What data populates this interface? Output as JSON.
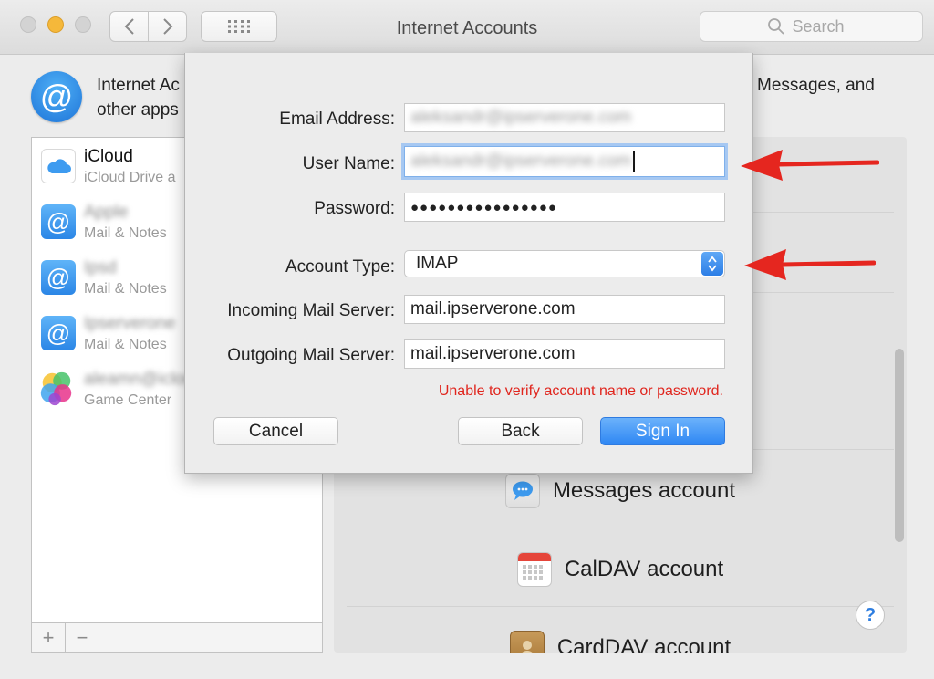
{
  "window": {
    "title": "Internet Accounts",
    "search_placeholder": "Search"
  },
  "header": {
    "description_line1": "Internet Ac",
    "description_line2": "other apps",
    "description_right": "Messages, and"
  },
  "accounts": [
    {
      "name": "iCloud",
      "subtitle": "iCloud Drive a",
      "icon": "cloud-icon",
      "name_blurred": false
    },
    {
      "name": "Apple",
      "subtitle": "Mail & Notes",
      "icon": "at-icon",
      "name_blurred": true
    },
    {
      "name": "Ipsd",
      "subtitle": "Mail & Notes",
      "icon": "at-icon",
      "name_blurred": true
    },
    {
      "name": "Ipserverone",
      "subtitle": "Mail & Notes",
      "icon": "at-icon",
      "name_blurred": true
    },
    {
      "name": "aleamn@icloud",
      "subtitle": "Game Center",
      "icon": "game-center-icon",
      "name_blurred": true
    }
  ],
  "list_controls": {
    "add": "+",
    "remove": "−"
  },
  "providers": [
    {
      "label": "Messages account",
      "icon": "messages-icon"
    },
    {
      "label": "CalDAV account",
      "icon": "calendar-icon"
    },
    {
      "label": "CardDAV account",
      "icon": "contacts-icon"
    }
  ],
  "help": "?",
  "sheet": {
    "email_label": "Email Address:",
    "email_value": "aleksandr@ipserverone.com",
    "username_label": "User Name:",
    "username_value": "aleksandr@ipserverone.com",
    "password_label": "Password:",
    "password_value": "●●●●●●●●●●●●●●●●",
    "account_type_label": "Account Type:",
    "account_type_value": "IMAP",
    "incoming_label": "Incoming Mail Server:",
    "incoming_value": "mail.ipserverone.com",
    "outgoing_label": "Outgoing Mail Server:",
    "outgoing_value": "mail.ipserverone.com",
    "error": "Unable to verify account name or password.",
    "cancel": "Cancel",
    "back": "Back",
    "sign_in": "Sign In"
  },
  "colors": {
    "accent": "#2f87f3",
    "error": "#e0251d",
    "annotation_arrow": "#e5261f",
    "traffic_close": "#d0d0d0",
    "traffic_minimize": "#f5b83a",
    "traffic_zoom": "#d0d0d0"
  }
}
